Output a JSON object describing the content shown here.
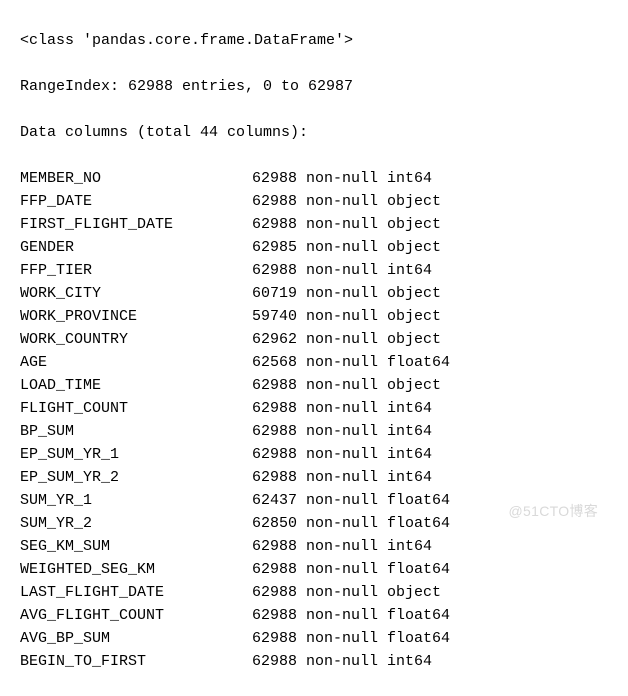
{
  "header": {
    "class_line": "<class 'pandas.core.frame.DataFrame'>",
    "range_line": "RangeIndex: 62988 entries, 0 to 62987",
    "columns_line": "Data columns (total 44 columns):"
  },
  "columns": [
    {
      "name": "MEMBER_NO",
      "count": "62988",
      "null": "non-null",
      "dtype": "int64"
    },
    {
      "name": "FFP_DATE",
      "count": "62988",
      "null": "non-null",
      "dtype": "object"
    },
    {
      "name": "FIRST_FLIGHT_DATE",
      "count": "62988",
      "null": "non-null",
      "dtype": "object"
    },
    {
      "name": "GENDER",
      "count": "62985",
      "null": "non-null",
      "dtype": "object"
    },
    {
      "name": "FFP_TIER",
      "count": "62988",
      "null": "non-null",
      "dtype": "int64"
    },
    {
      "name": "WORK_CITY",
      "count": "60719",
      "null": "non-null",
      "dtype": "object"
    },
    {
      "name": "WORK_PROVINCE",
      "count": "59740",
      "null": "non-null",
      "dtype": "object"
    },
    {
      "name": "WORK_COUNTRY",
      "count": "62962",
      "null": "non-null",
      "dtype": "object"
    },
    {
      "name": "AGE",
      "count": "62568",
      "null": "non-null",
      "dtype": "float64"
    },
    {
      "name": "LOAD_TIME",
      "count": "62988",
      "null": "non-null",
      "dtype": "object"
    },
    {
      "name": "FLIGHT_COUNT",
      "count": "62988",
      "null": "non-null",
      "dtype": "int64"
    },
    {
      "name": "BP_SUM",
      "count": "62988",
      "null": "non-null",
      "dtype": "int64"
    },
    {
      "name": "EP_SUM_YR_1",
      "count": "62988",
      "null": "non-null",
      "dtype": "int64"
    },
    {
      "name": "EP_SUM_YR_2",
      "count": "62988",
      "null": "non-null",
      "dtype": "int64"
    },
    {
      "name": "SUM_YR_1",
      "count": "62437",
      "null": "non-null",
      "dtype": "float64"
    },
    {
      "name": "SUM_YR_2",
      "count": "62850",
      "null": "non-null",
      "dtype": "float64"
    },
    {
      "name": "SEG_KM_SUM",
      "count": "62988",
      "null": "non-null",
      "dtype": "int64"
    },
    {
      "name": "WEIGHTED_SEG_KM",
      "count": "62988",
      "null": "non-null",
      "dtype": "float64"
    },
    {
      "name": "LAST_FLIGHT_DATE",
      "count": "62988",
      "null": "non-null",
      "dtype": "object"
    },
    {
      "name": "AVG_FLIGHT_COUNT",
      "count": "62988",
      "null": "non-null",
      "dtype": "float64"
    },
    {
      "name": "AVG_BP_SUM",
      "count": "62988",
      "null": "non-null",
      "dtype": "float64"
    },
    {
      "name": "BEGIN_TO_FIRST",
      "count": "62988",
      "null": "non-null",
      "dtype": "int64"
    }
  ],
  "watermark": "@51CTO博客"
}
